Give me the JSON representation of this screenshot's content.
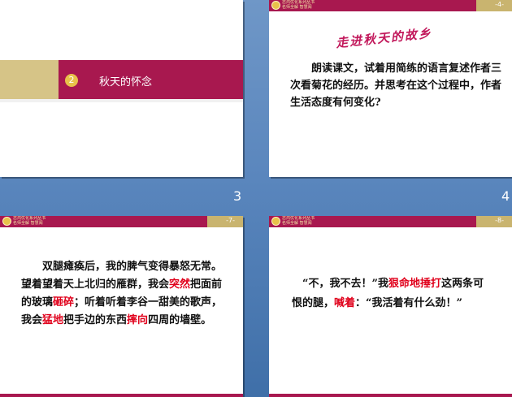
{
  "slide1": {
    "number_badge": "2",
    "title": "秋天的怀念",
    "page_number": "3"
  },
  "slide2": {
    "header_num": "-4-",
    "logo_line1": "志鸿优化系列丛书",
    "logo_line2": "名师全解 智慧阅",
    "calligraphy_title": "走进秋天的故乡",
    "text": "朗读课文，试着用简练的语言复述作者三次看菊花的经历。并思考在这个过程中，作者生活态度有何变化?",
    "page_number": "4"
  },
  "slide3": {
    "header_num": "-7-",
    "logo_line1": "志鸿优化系列丛书",
    "logo_line2": "名师全解 智慧阅",
    "segments": [
      {
        "text": "双腿瘫痪后，我的脾气变得暴怒无常。望着望着天上北归的雁群，我会",
        "red": false
      },
      {
        "text": "突然",
        "red": true
      },
      {
        "text": "把面前的玻璃",
        "red": false
      },
      {
        "text": "砸碎",
        "red": true
      },
      {
        "text": "；听着听着李谷一甜美的歌声，我会",
        "red": false
      },
      {
        "text": "猛地",
        "red": true
      },
      {
        "text": "把手边的东西",
        "red": false
      },
      {
        "text": "摔向",
        "red": true
      },
      {
        "text": "四周的墙壁。",
        "red": false
      }
    ]
  },
  "slide4": {
    "header_num": "-8-",
    "logo_line1": "志鸿优化系列丛书",
    "logo_line2": "名师全解 智慧阅",
    "segments": [
      {
        "text": "“不，我不去！”我",
        "red": false
      },
      {
        "text": "狠命地捶打",
        "red": true
      },
      {
        "text": "这两条可恨的腿，",
        "red": false
      },
      {
        "text": "喊着",
        "red": true
      },
      {
        "text": "：“我活着有什么劲！”",
        "red": false
      }
    ]
  },
  "colors": {
    "magenta": "#a8184f",
    "gold": "#c9b46f",
    "highlight_red": "#e0001b",
    "background_blue": "#5a86bd"
  }
}
